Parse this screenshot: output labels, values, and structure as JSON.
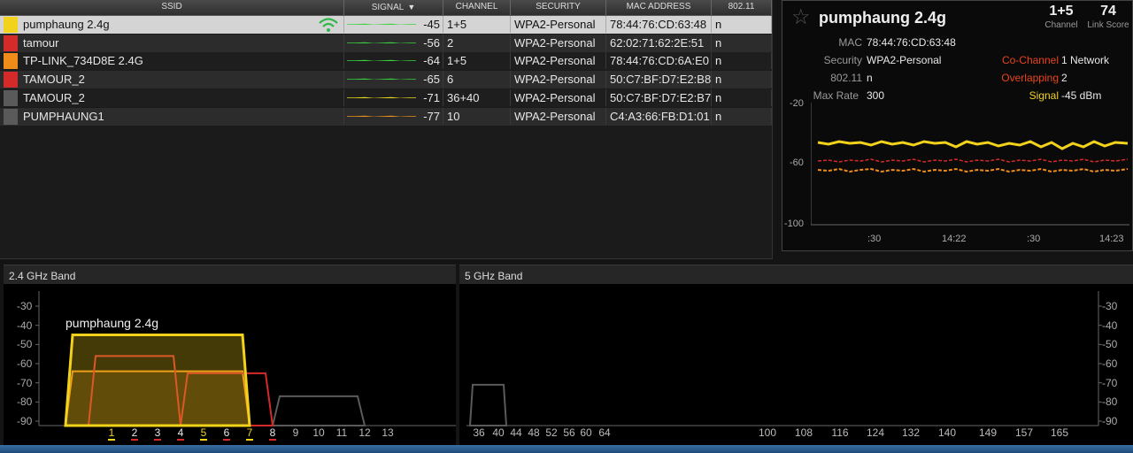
{
  "table": {
    "headers": [
      "SSID",
      "SIGNAL",
      "CHANNEL",
      "SECURITY",
      "MAC ADDRESS",
      "802.11"
    ],
    "sort_icon": "sort-down-icon",
    "rows": [
      {
        "ssid": "pumphaung 2.4g",
        "signal": "-45",
        "channel": "1+5",
        "security": "WPA2-Personal",
        "mac": "78:44:76:CD:63:48",
        "mode": "n",
        "color": "#f2d21a",
        "line_color": "#37d43c",
        "connected": true
      },
      {
        "ssid": "tamour",
        "signal": "-56",
        "channel": "2",
        "security": "WPA2-Personal",
        "mac": "62:02:71:62:2E:51",
        "mode": "n",
        "color": "#d42a2a",
        "line_color": "#37d43c"
      },
      {
        "ssid": "TP-LINK_734D8E 2.4G",
        "signal": "-64",
        "channel": "1+5",
        "security": "WPA2-Personal",
        "mac": "78:44:76:CD:6A:E0",
        "mode": "n",
        "color": "#f08c19",
        "line_color": "#37d43c"
      },
      {
        "ssid": "TAMOUR_2",
        "signal": "-65",
        "channel": "6",
        "security": "WPA2-Personal",
        "mac": "50:C7:BF:D7:E2:B8",
        "mode": "n",
        "color": "#d42a2a",
        "line_color": "#37d43c"
      },
      {
        "ssid": "TAMOUR_2",
        "signal": "-71",
        "channel": "36+40",
        "security": "WPA2-Personal",
        "mac": "50:C7:BF:D7:E2:B7",
        "mode": "n",
        "color": "#5a5a5a",
        "line_color": "#e8d81c"
      },
      {
        "ssid": "PUMPHAUNG1",
        "signal": "-77",
        "channel": "10",
        "security": "WPA2-Personal",
        "mac": "C4:A3:66:FB:D1:01",
        "mode": "n",
        "color": "#5a5a5a",
        "line_color": "#e8911c"
      }
    ]
  },
  "detail": {
    "star_icon": "star-outline-icon",
    "ssid": "pumphaung 2.4g",
    "channel_value": "1+5",
    "channel_label": "Channel",
    "link_score_value": "74",
    "link_score_label": "Link Score",
    "mac_label": "MAC",
    "mac_value": "78:44:76:CD:63:48",
    "security_label": "Security",
    "security_value": "WPA2-Personal",
    "mode_label": "802.11",
    "mode_value": "n",
    "max_rate_label": "Max Rate",
    "max_rate_value": "300",
    "cochannel_label": "Co-Channel",
    "cochannel_value": "1 Network",
    "overlapping_label": "Overlapping",
    "overlapping_value": "2",
    "signal_label": "Signal",
    "signal_value": "-45 dBm",
    "colors": {
      "cochannel": "#e8441c",
      "overlapping": "#e8441c",
      "signal": "#f2d21a"
    },
    "graph": {
      "y_ticks": [
        "-20",
        "-60",
        "-100"
      ],
      "x_ticks": [
        ":30",
        "14:22",
        ":30",
        "14:23"
      ]
    }
  },
  "band24": {
    "title": "2.4 GHz Band",
    "y_ticks": [
      "-30",
      "-40",
      "-50",
      "-60",
      "-70",
      "-80",
      "-90"
    ],
    "channels": [
      "1",
      "2",
      "3",
      "4",
      "5",
      "6",
      "7",
      "8",
      "9",
      "10",
      "11",
      "12",
      "13"
    ],
    "highlighted_channels": {
      "1": "#f2d21a",
      "2": "#d42a2a",
      "3": "#d42a2a",
      "4": "#d42a2a",
      "5": "#f2d21a",
      "6": "#d42a2a",
      "7": "#f2d21a",
      "8": "#d42a2a"
    },
    "label": "pumphaung 2.4g",
    "chart_data": {
      "type": "area",
      "title": "",
      "xlabel": "",
      "ylabel": "",
      "ylim": [
        -95,
        -25
      ],
      "x_unit": "channel",
      "series": [
        {
          "name": "pumphaung 2.4g",
          "color": "#f2d21a",
          "from": -1,
          "to": 7,
          "level": -45
        },
        {
          "name": "tamour",
          "color": "#d42a2a",
          "from": 0,
          "to": 4,
          "level": -56
        },
        {
          "name": "TP-LINK_734D8E 2.4G",
          "color": "#f08c19",
          "from": -1,
          "to": 7,
          "level": -64
        },
        {
          "name": "TAMOUR_2",
          "color": "#d42a2a",
          "from": 4,
          "to": 8,
          "level": -65
        },
        {
          "name": "PUMPHAUNG1",
          "color": "#5a5a5a",
          "from": 8,
          "to": 12,
          "level": -77
        }
      ]
    }
  },
  "band5": {
    "title": "5 GHz Band",
    "y_ticks": [
      "-30",
      "-40",
      "-50",
      "-60",
      "-70",
      "-80",
      "-90"
    ],
    "channels": [
      "36",
      "40",
      "44",
      "48",
      "52",
      "56",
      "60",
      "64",
      "100",
      "108",
      "116",
      "124",
      "132",
      "140",
      "149",
      "157",
      "165"
    ],
    "chart_data": {
      "type": "area",
      "title": "",
      "xlabel": "",
      "ylabel": "",
      "ylim": [
        -95,
        -25
      ],
      "series": [
        {
          "name": "TAMOUR_2",
          "color": "#5a5a5a",
          "channels": [
            "36",
            "40"
          ],
          "level": -71
        }
      ]
    }
  }
}
